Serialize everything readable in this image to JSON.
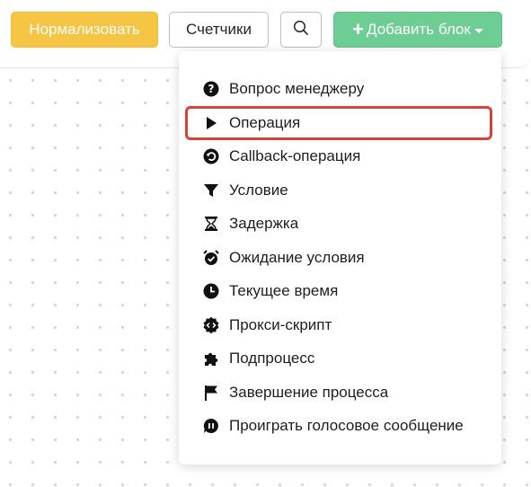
{
  "toolbar": {
    "normalize_label": "Нормализовать",
    "counters_label": "Счетчики",
    "add_block_label": "Добавить блок"
  },
  "colors": {
    "normalize_bg": "#f7c544",
    "add_block_bg": "#6dcd93",
    "highlight_border": "#d9413a"
  },
  "menu": {
    "items": [
      {
        "label": "Вопрос менеджеру",
        "icon": "question-circle-icon"
      },
      {
        "label": "Операция",
        "icon": "play-icon",
        "highlighted": true
      },
      {
        "label": "Callback-операция",
        "icon": "undo-circle-icon"
      },
      {
        "label": "Условие",
        "icon": "filter-icon"
      },
      {
        "label": "Задержка",
        "icon": "hourglass-icon"
      },
      {
        "label": "Ожидание условия",
        "icon": "alarm-clock-icon"
      },
      {
        "label": "Текущее время",
        "icon": "clock-icon"
      },
      {
        "label": "Прокси-скрипт",
        "icon": "code-badge-icon"
      },
      {
        "label": "Подпроцесс",
        "icon": "puzzle-icon"
      },
      {
        "label": "Завершение процесса",
        "icon": "flag-icon"
      },
      {
        "label": "Проиграть голосовое сообщение",
        "icon": "voice-message-icon"
      }
    ]
  }
}
